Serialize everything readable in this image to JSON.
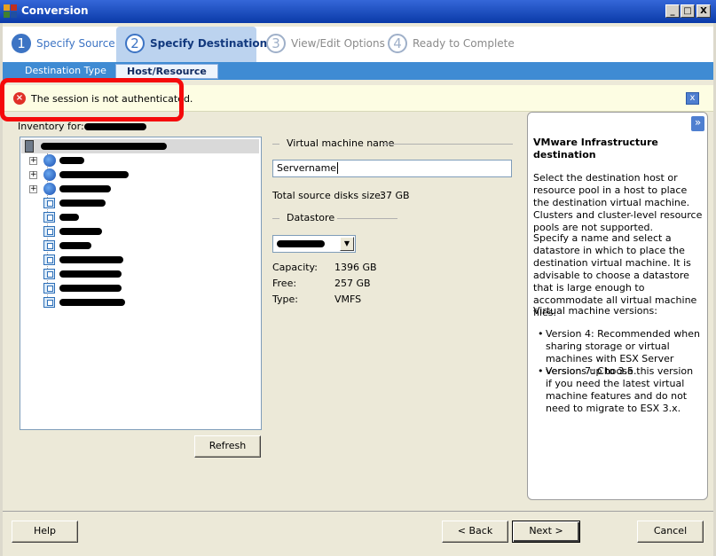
{
  "window": {
    "title": "Conversion",
    "controls": [
      "_",
      "□",
      "X"
    ]
  },
  "steps": [
    {
      "num": "1",
      "label": "Specify Source",
      "state": "done"
    },
    {
      "num": "2",
      "label": "Specify Destination",
      "state": "active"
    },
    {
      "num": "3",
      "label": "View/Edit Options",
      "state": "pending"
    },
    {
      "num": "4",
      "label": "Ready to Complete",
      "state": "pending"
    }
  ],
  "subtabs": [
    {
      "label": "Destination Type",
      "active": false
    },
    {
      "label": "Host/Resource",
      "active": true
    }
  ],
  "error": {
    "message": "The session is not authenticated.",
    "close": "x"
  },
  "inventory": {
    "label": "Inventory for:",
    "redacted": true
  },
  "tree": {
    "root": "redacted",
    "items": [
      {
        "type": "host",
        "expandable": true
      },
      {
        "type": "host",
        "expandable": true
      },
      {
        "type": "host",
        "expandable": true
      },
      {
        "type": "vm"
      },
      {
        "type": "vm"
      },
      {
        "type": "vm"
      },
      {
        "type": "vm"
      },
      {
        "type": "vm"
      },
      {
        "type": "vm"
      },
      {
        "type": "vm"
      }
    ]
  },
  "refresh_label": "Refresh",
  "vm": {
    "section_title": "Virtual machine name",
    "name_value": "Servername",
    "disk_size_label": "Total source disks size:",
    "disk_size_value": "37 GB"
  },
  "datastore": {
    "section_title": "Datastore",
    "capacity_label": "Capacity:",
    "capacity_value": "1396 GB",
    "free_label": "Free:",
    "free_value": "257 GB",
    "type_label": "Type:",
    "type_value": "VMFS"
  },
  "help": {
    "title": "VMware Infrastructure destination",
    "para1": "Select the destination host or resource pool in a host to place the destination virtual machine. Clusters and cluster-level resource pools are not supported.",
    "para2": "Specify a name and select a datastore in which to place the destination virtual machine. It is advisable to choose a datastore that is large enough to accommodate all virtual machine files.",
    "versions_title": "Virtual machine versions:",
    "bullet1": "Version 4: Recommended when sharing storage or virtual machines with ESX Server versions up to 3.5.",
    "bullet2": "Version 7: Choose this version if you need the latest virtual machine features and do not need to migrate to ESX 3.x.",
    "collapse": "»"
  },
  "buttons": {
    "help": "Help",
    "back": "< Back",
    "next": "Next >",
    "cancel": "Cancel"
  }
}
